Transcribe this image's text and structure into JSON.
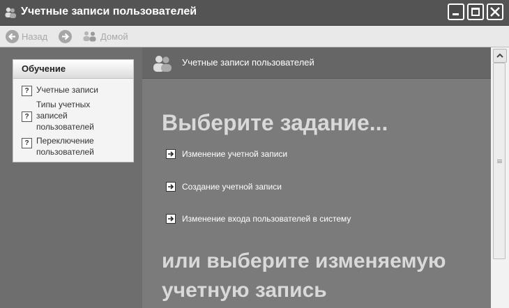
{
  "window": {
    "title": "Учетные записи пользователей"
  },
  "nav": {
    "back_label": "Назад",
    "home_label": "Домой"
  },
  "left_panel": {
    "title": "Обучение",
    "links": [
      {
        "label": "Учетные записи",
        "icon": "help-icon"
      },
      {
        "label": "Типы учетных записей пользователей",
        "icon": "help-icon"
      },
      {
        "label": "Переключение пользователей",
        "icon": "help-icon"
      }
    ]
  },
  "main": {
    "header_title": "Учетные записи пользователей",
    "pick_task_heading": "Выберите задание...",
    "tasks": [
      {
        "label": "Изменение учетной записи",
        "icon": "arrow-right-icon"
      },
      {
        "label": "Создание учетной записи",
        "icon": "arrow-right-icon"
      },
      {
        "label": "Изменение входа пользователей в систему",
        "icon": "arrow-right-icon"
      }
    ],
    "pick_account_heading": "или выберите изменяемую учетную запись"
  },
  "colors": {
    "titlebar": "#545454",
    "content_bg": "#7b7b7b",
    "heading_text": "#d9d9d9"
  }
}
